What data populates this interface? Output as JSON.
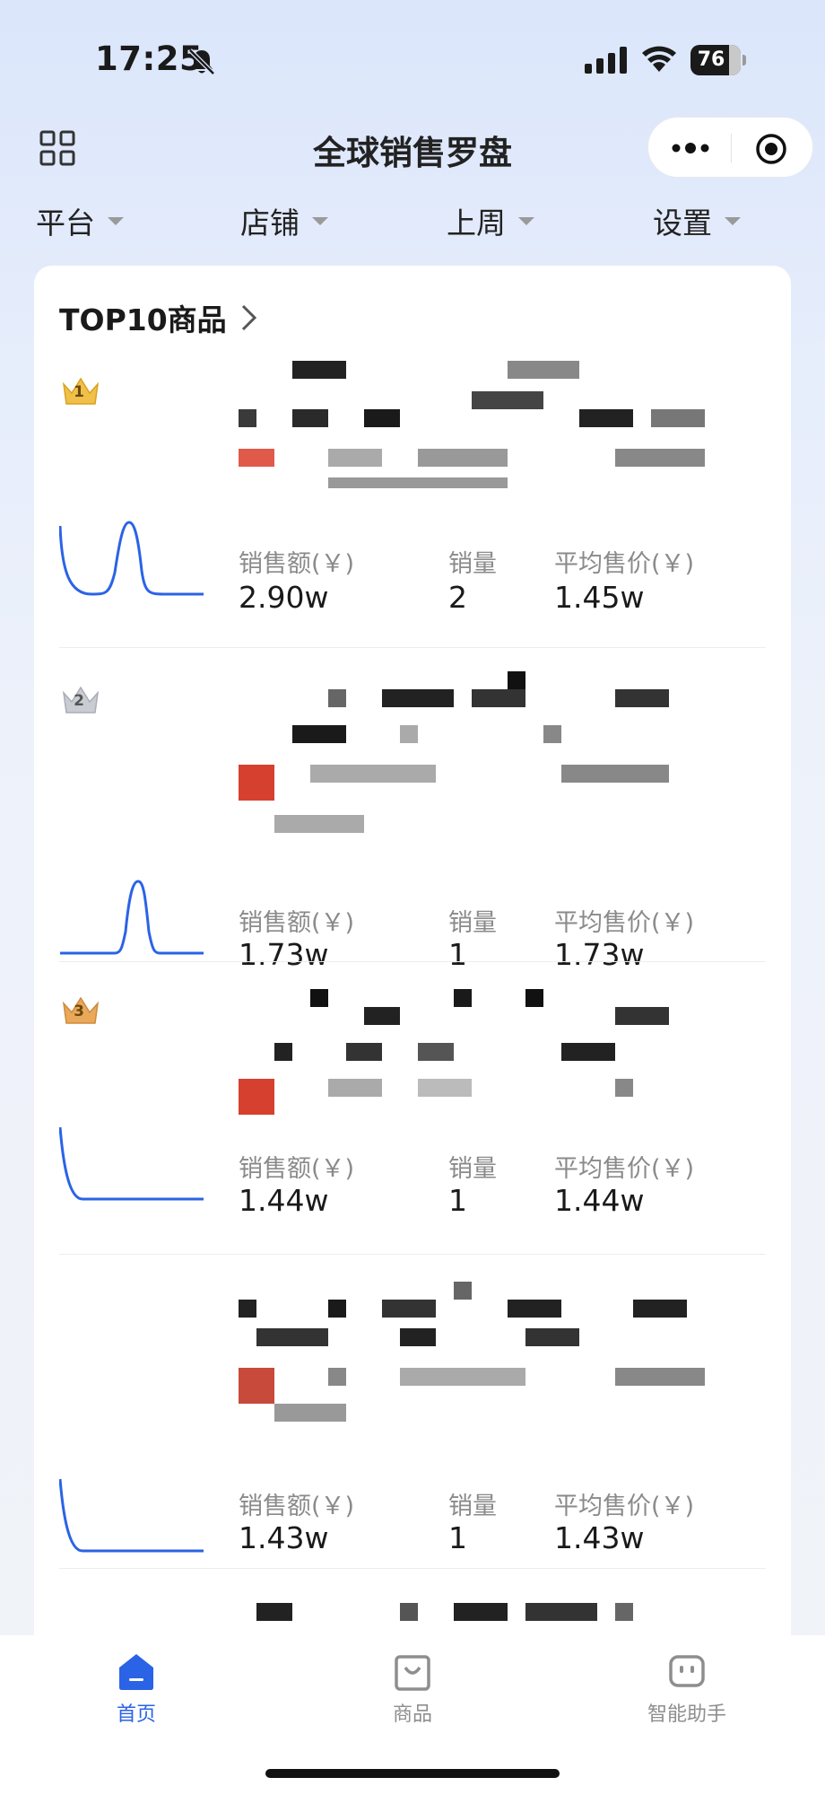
{
  "status_bar": {
    "time": "17:25",
    "battery": "76"
  },
  "nav": {
    "title": "全球销售罗盘"
  },
  "filters": [
    {
      "label": "平台"
    },
    {
      "label": "店铺"
    },
    {
      "label": "上周"
    },
    {
      "label": "设置"
    }
  ],
  "section": {
    "title": "TOP10商品"
  },
  "metric_labels": {
    "sales_amount": "销售额(￥)",
    "sales_volume": "销量",
    "avg_price": "平均售价(￥)"
  },
  "products": [
    {
      "rank": "1",
      "sales_amount": "2.90w",
      "sales_volume": "2",
      "avg_price": "1.45w"
    },
    {
      "rank": "2",
      "sales_amount": "1.73w",
      "sales_volume": "1",
      "avg_price": "1.73w"
    },
    {
      "rank": "3",
      "sales_amount": "1.44w",
      "sales_volume": "1",
      "avg_price": "1.44w"
    },
    {
      "rank": "",
      "sales_amount": "1.43w",
      "sales_volume": "1",
      "avg_price": "1.43w"
    }
  ],
  "tabbar": {
    "home": "首页",
    "products": "商品",
    "assistant": "智能助手"
  },
  "colors": {
    "accent": "#2b63e6",
    "gold_crown": "#f0c04a",
    "silver_crown": "#c9ccd2",
    "bronze_crown": "#e9a85a"
  }
}
